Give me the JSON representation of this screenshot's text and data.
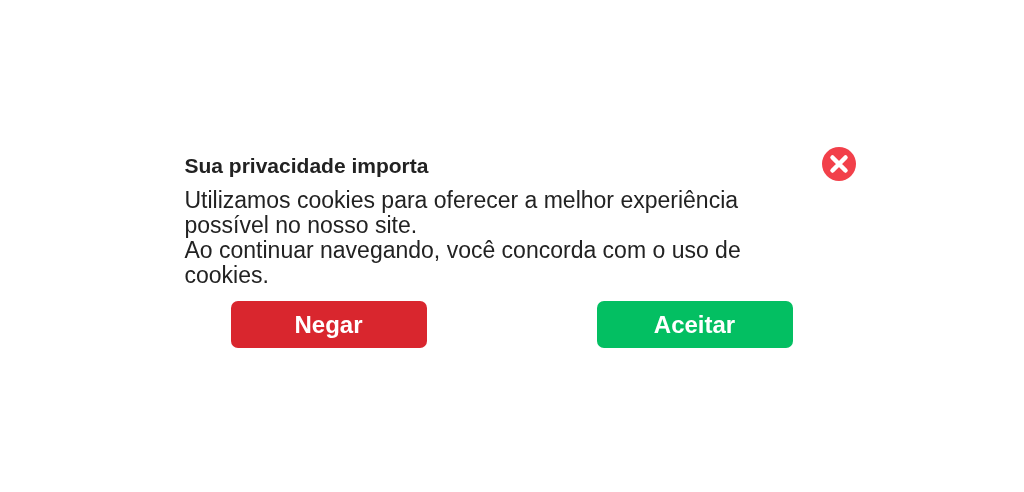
{
  "dialog": {
    "title": "Sua privacidade importa",
    "paragraphs": [
      "Utilizamos cookies para oferecer a melhor experiência possível no nosso site.",
      "Ao continuar navegando, você concorda com o uso de cookies."
    ],
    "buttons": [
      {
        "label": "Negar",
        "kind": "deny"
      },
      {
        "label": "Aceitar",
        "kind": "accept"
      }
    ]
  }
}
